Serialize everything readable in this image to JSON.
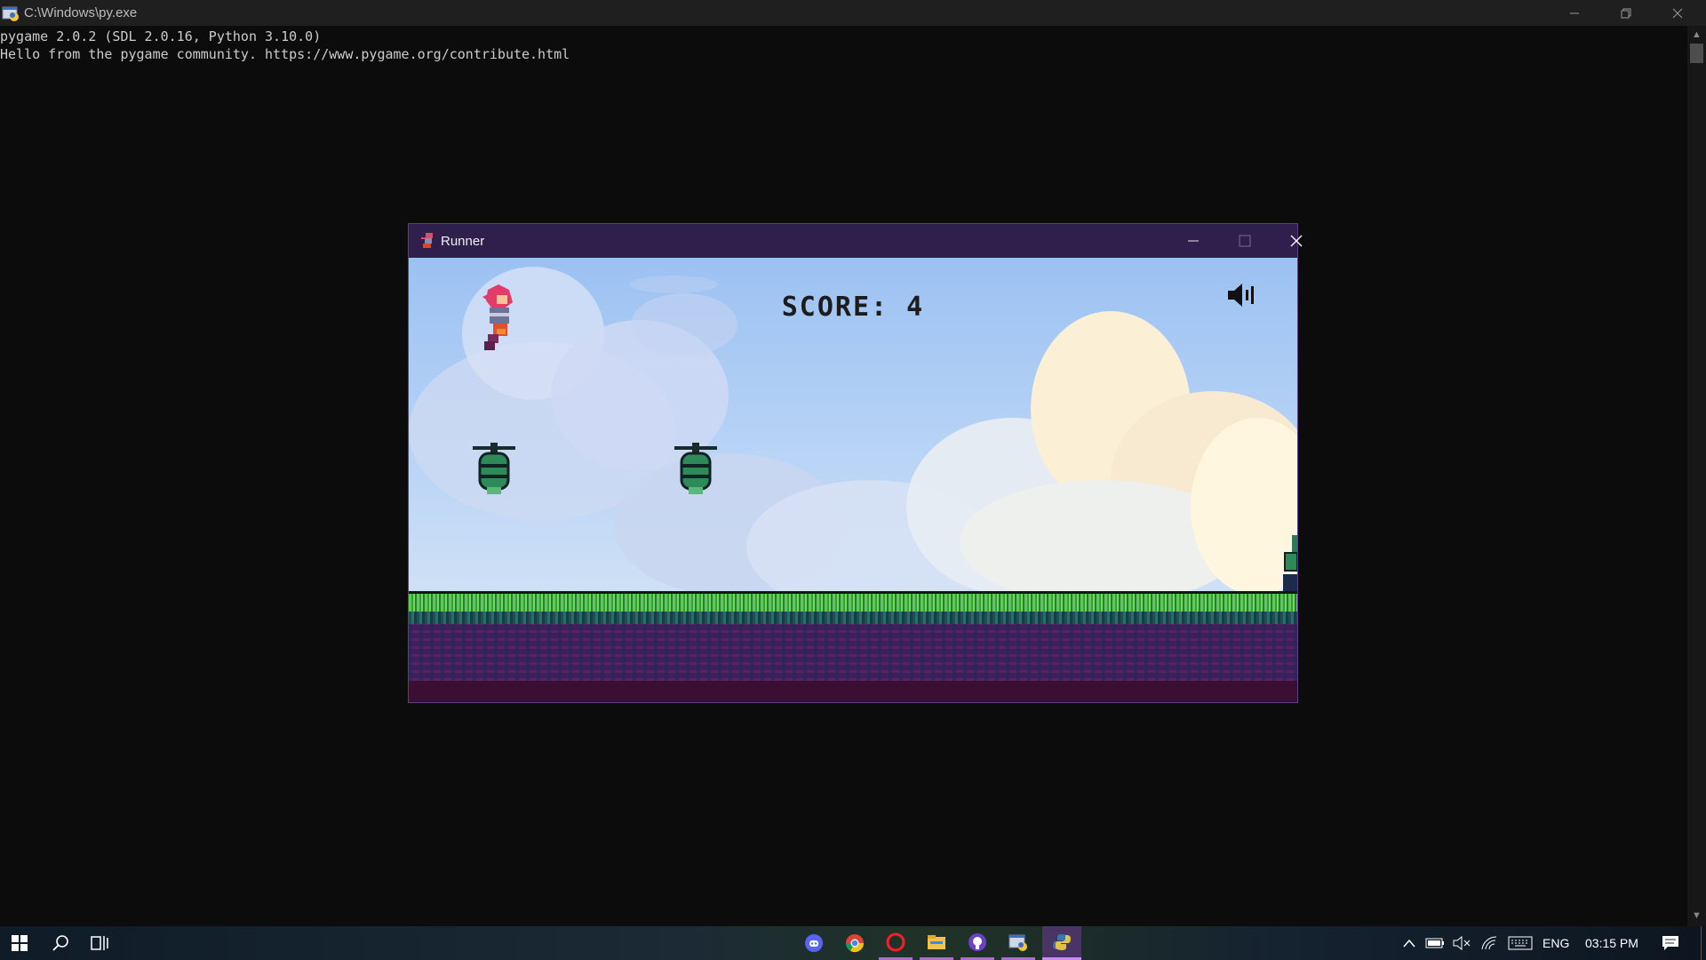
{
  "console": {
    "title": "C:\\Windows\\py.exe",
    "lines": [
      "pygame 2.0.2 (SDL 2.0.16, Python 3.10.0)",
      "Hello from the pygame community. https://www.pygame.org/contribute.html"
    ]
  },
  "game": {
    "title": "Runner",
    "score_text": "SCORE: 4",
    "score": 4,
    "sound_state": "on",
    "icons": [
      "player-icon",
      "fly-enemy-icon",
      "snail-enemy-icon",
      "speaker-icon"
    ]
  },
  "taskbar": {
    "apps": [
      "discord-icon",
      "chrome-icon",
      "opera-icon",
      "file-explorer-icon",
      "github-desktop-icon",
      "py-console-icon",
      "python-game-icon"
    ],
    "language": "ENG",
    "time": "03:15 PM"
  },
  "colors": {
    "game_title_bar": "#2e1f4d",
    "taskbar": "#0e1a2a",
    "console_bg": "#0c0c0c",
    "sky": "#9cc1f2"
  }
}
